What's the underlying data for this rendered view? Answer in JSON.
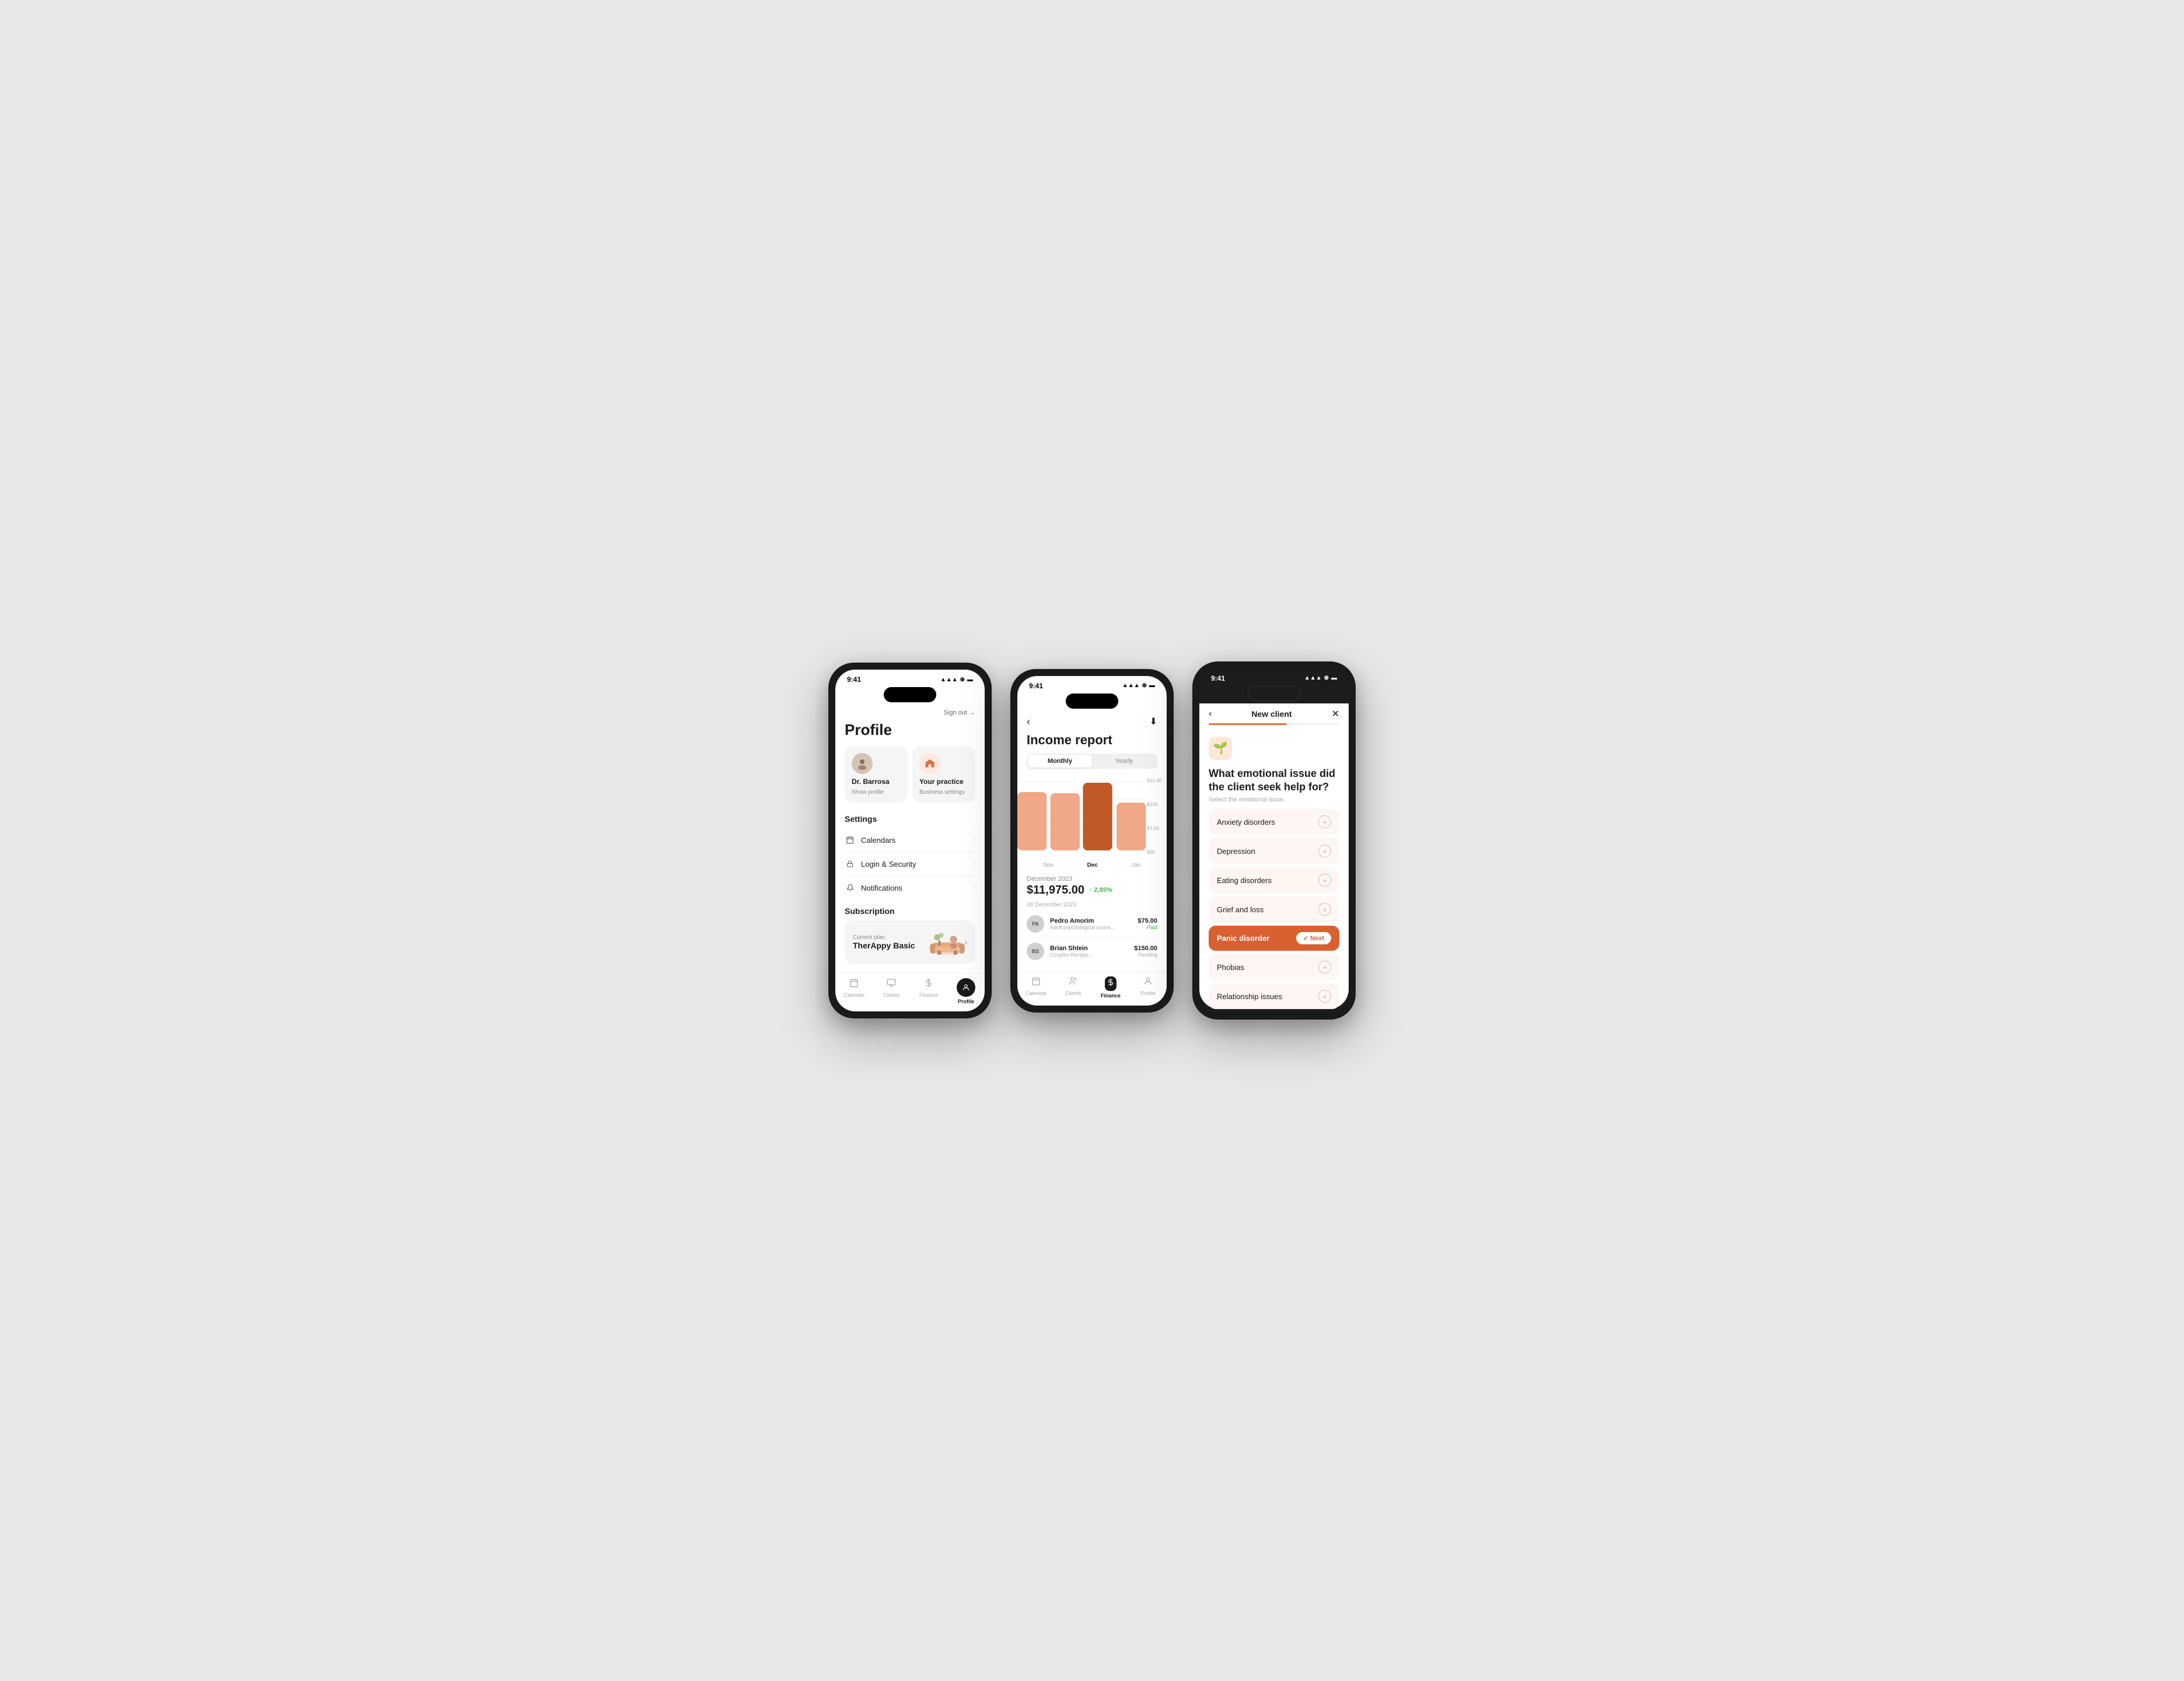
{
  "bg_color": "#e8e8e8",
  "phones": [
    {
      "id": "phone1",
      "theme": "light",
      "status": {
        "time": "9:41",
        "signal": "●●●",
        "wifi": "wifi",
        "battery": "battery"
      },
      "header": {
        "sign_out": "Sign out →"
      },
      "title": "Profile",
      "user_card": {
        "name": "Dr. Barrosa",
        "sub": "Show profile"
      },
      "practice_card": {
        "name": "Your practice",
        "sub": "Business settings"
      },
      "settings": {
        "title": "Settings",
        "items": [
          {
            "icon": "📅",
            "label": "Calendars"
          },
          {
            "icon": "🔒",
            "label": "Login & Security"
          },
          {
            "icon": "🔔",
            "label": "Notifications"
          }
        ]
      },
      "subscription": {
        "title": "Subscription",
        "plan_label": "Current plan",
        "plan_name": "TherAppy Basic"
      },
      "tabs": [
        {
          "icon": "📅",
          "label": "Calendar",
          "active": false
        },
        {
          "icon": "👤",
          "label": "Clients",
          "active": false
        },
        {
          "icon": "💰",
          "label": "Finance",
          "active": false
        },
        {
          "icon": "👤",
          "label": "Profile",
          "active": true
        }
      ]
    },
    {
      "id": "phone2",
      "theme": "light",
      "status": {
        "time": "9:41"
      },
      "title": "Income report",
      "period": {
        "options": [
          "Monthly",
          "Yearly"
        ],
        "active": "Monthly"
      },
      "chart": {
        "bars": [
          {
            "label": "Nov",
            "height": 0.72,
            "color": "#f0a080",
            "active": false
          },
          {
            "label": "Dec",
            "height": 0.9,
            "color": "#d06030",
            "active": true
          },
          {
            "label": "Jan",
            "height": 0.6,
            "color": "#f0a080",
            "active": false
          }
        ],
        "y_labels": [
          "$12,5K",
          "$10K",
          "$7,5K",
          "$5K"
        ]
      },
      "income": {
        "month": "December 2023",
        "amount": "$11,975.00",
        "change": "↑ 2,85%"
      },
      "transactions_date": "28 December 2023",
      "transactions": [
        {
          "initials": "PA",
          "name": "Pedro Amorim",
          "type": "Adult psychological couns...",
          "amount": "$75.00",
          "status": "Paid",
          "paid": true
        },
        {
          "initials": "BS",
          "name": "Brian Shtein",
          "type": "Couples therapy...",
          "amount": "$150.00",
          "status": "Pending",
          "paid": false
        }
      ],
      "tabs": [
        {
          "label": "Calendar",
          "active": false
        },
        {
          "label": "Clients",
          "active": false
        },
        {
          "label": "Finance",
          "active": true
        },
        {
          "label": "Profile",
          "active": false
        }
      ]
    },
    {
      "id": "phone3",
      "theme": "dark",
      "status": {
        "time": "9:41"
      },
      "nav": {
        "title": "New client",
        "back": "‹",
        "close": "✕"
      },
      "progress": 60,
      "question": "What emotional issue did the client seek help for?",
      "subtitle": "Select the emotional issue.",
      "issues": [
        {
          "label": "Anxiety disorders",
          "selected": false
        },
        {
          "label": "Depression",
          "selected": false
        },
        {
          "label": "Eating disorders",
          "selected": false
        },
        {
          "label": "Grief and loss",
          "selected": false
        },
        {
          "label": "Panic disorder",
          "selected": true
        },
        {
          "label": "Phobias",
          "selected": false
        },
        {
          "label": "Relationship issues",
          "selected": false
        }
      ],
      "next_label": "✓ Next"
    }
  ]
}
